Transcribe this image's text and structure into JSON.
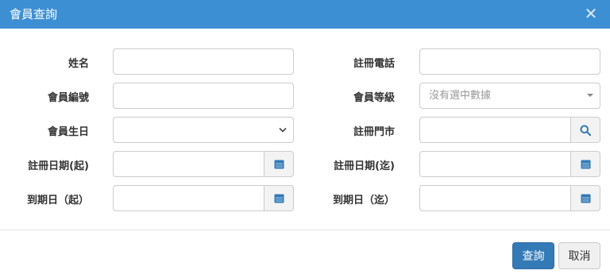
{
  "dialog": {
    "title": "會員查詢",
    "close_glyph": "✕"
  },
  "fields": {
    "name_label": "姓名",
    "phone_label": "註冊電話",
    "member_no_label": "會員編號",
    "level_label": "會員等級",
    "level_placeholder": "沒有選中數據",
    "birthday_label": "會員生日",
    "store_label": "註冊門市",
    "reg_from_label": "註冊日期(起)",
    "reg_to_label": "註冊日期(迄)",
    "exp_from_label": "到期日（起）",
    "exp_to_label": "到期日（迄）"
  },
  "footer": {
    "search_label": "查詢",
    "cancel_label": "取消"
  },
  "colors": {
    "titlebar": "#3d8fd4",
    "primary": "#337ab7",
    "icon": "#337ab7"
  },
  "icons": [
    "close-icon",
    "chevron-down-icon",
    "search-icon",
    "calendar-icon"
  ]
}
